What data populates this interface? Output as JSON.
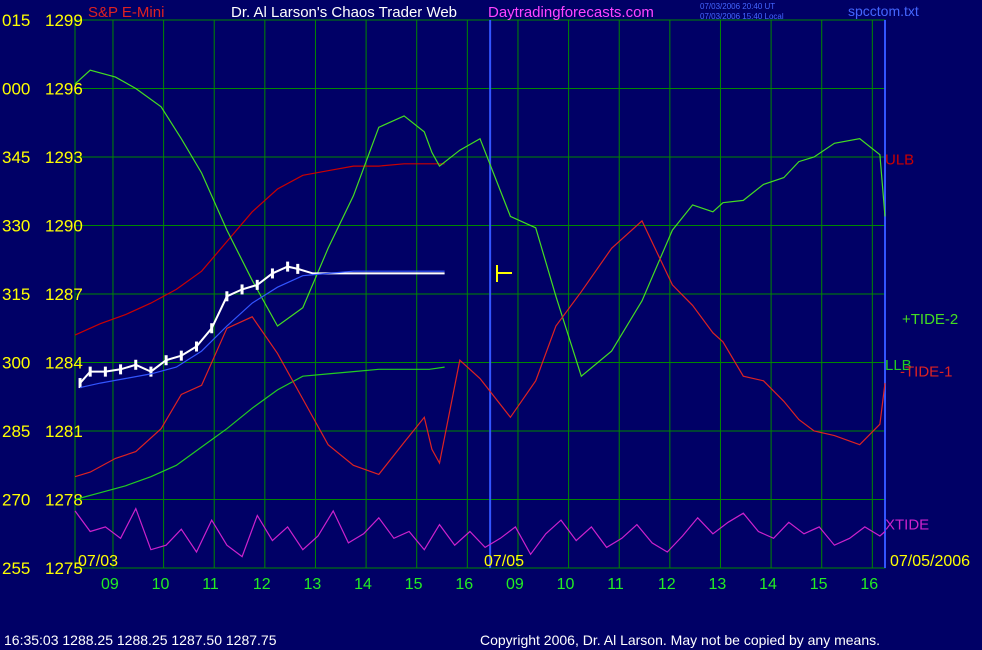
{
  "header": {
    "symbol": "S&P E-Mini",
    "title": "Dr. Al Larson's Chaos Trader Web",
    "site": "Daytradingforecasts.com",
    "timestamp_ut": "07/03/2006 20:40 UT",
    "timestamp_local": "07/03/2006 15:40 Local",
    "file": "spcctom.txt"
  },
  "footer": {
    "quote": "16:35:03  1288.25 1288.25 1287.50 1287.75",
    "copyright": "Copyright 2006, Dr. Al Larson. May not be copied by any means."
  },
  "colors": {
    "background": "#000066",
    "grid": "#008800",
    "price": "#ffffff",
    "ulb": "#cc0000",
    "llb": "#22cc22",
    "tide2": "#44dd22",
    "tide1": "#dd2222",
    "xtide": "#cc22cc",
    "ma": "#3355ff",
    "date_label": "#ffff00",
    "hour_label": "#22ee22",
    "left_axis": "#ffff00",
    "title": "#ffffff",
    "site": "#ff44ff"
  },
  "chart_data": {
    "type": "line",
    "title": "Dr. Al Larson's Chaos Trader Web",
    "y_axis": {
      "ticks": [
        1278,
        1281,
        1284,
        1287,
        1290,
        1293,
        1296,
        1299
      ],
      "ylim": [
        1278,
        1299
      ],
      "left_labels": [
        "255",
        "270",
        "285",
        "300",
        "315",
        "330",
        "345",
        "000",
        "015"
      ],
      "right_labels_top": [
        "1275",
        "1278",
        "1281",
        "1284",
        "1287",
        "1290",
        "1293",
        "1296",
        "1299"
      ]
    },
    "x_axis": {
      "hours": [
        "09",
        "10",
        "11",
        "12",
        "13",
        "14",
        "15",
        "16",
        "09",
        "10",
        "11",
        "12",
        "13",
        "14",
        "15",
        "16"
      ],
      "dates": [
        "07/03",
        "07/05",
        "07/05/2006"
      ],
      "xlim": [
        8.25,
        16
      ]
    },
    "series": [
      {
        "name": "ULB",
        "color_key": "ulb",
        "x": [
          0,
          0.5,
          1.0,
          1.5,
          2.0,
          2.5,
          3.0,
          3.5,
          4.0,
          4.5,
          5.0,
          5.5,
          6.0,
          6.5,
          7.0,
          7.3
        ],
        "y": [
          1285.2,
          1285.7,
          1286.1,
          1286.6,
          1287.2,
          1288.0,
          1289.3,
          1290.6,
          1291.6,
          1292.2,
          1292.4,
          1292.6,
          1292.6,
          1292.7,
          1292.7,
          1292.7
        ]
      },
      {
        "name": "LLB",
        "color_key": "llb",
        "x": [
          0,
          0.5,
          1.0,
          1.5,
          2.0,
          2.5,
          3.0,
          3.5,
          4.0,
          4.5,
          5.0,
          5.5,
          6.0,
          6.5,
          7.0,
          7.3
        ],
        "y": [
          1278.0,
          1278.3,
          1278.6,
          1279.0,
          1279.5,
          1280.3,
          1281.1,
          1282.0,
          1282.8,
          1283.4,
          1283.5,
          1283.6,
          1283.7,
          1283.7,
          1283.7,
          1283.8
        ]
      },
      {
        "name": "+TIDE-2",
        "color_key": "tide2",
        "x": [
          0,
          0.3,
          0.8,
          1.2,
          1.7,
          2.1,
          2.5,
          3.0,
          3.5,
          4.0,
          4.5,
          5.0,
          5.5,
          6.0,
          6.5,
          6.9,
          7.05,
          7.2,
          7.6,
          8.0,
          8.6,
          9.1,
          9.5,
          10.0,
          10.6,
          11.2,
          11.8,
          12.2,
          12.6,
          12.8,
          13.2,
          13.6,
          14.0,
          14.3,
          14.6,
          15.0,
          15.5,
          15.9,
          16.0
        ],
        "y": [
          1296.2,
          1296.8,
          1296.5,
          1296.0,
          1295.2,
          1293.8,
          1292.3,
          1289.8,
          1287.6,
          1285.6,
          1286.4,
          1289.0,
          1291.3,
          1294.3,
          1294.8,
          1294.1,
          1293.2,
          1292.6,
          1293.3,
          1293.8,
          1290.4,
          1289.9,
          1286.9,
          1283.4,
          1284.5,
          1286.7,
          1289.8,
          1290.9,
          1290.6,
          1291.0,
          1291.1,
          1291.8,
          1292.1,
          1292.8,
          1293.0,
          1293.6,
          1293.8,
          1293.1,
          1290.4
        ]
      },
      {
        "name": "-TIDE-1",
        "color_key": "tide1",
        "x": [
          0,
          0.3,
          0.8,
          1.2,
          1.7,
          2.1,
          2.5,
          3.0,
          3.5,
          4.0,
          4.5,
          5.0,
          5.5,
          6.0,
          6.5,
          6.9,
          7.05,
          7.2,
          7.6,
          8.0,
          8.6,
          9.1,
          9.5,
          10.0,
          10.6,
          11.2,
          11.8,
          12.2,
          12.6,
          12.8,
          13.2,
          13.6,
          14.0,
          14.3,
          14.6,
          15.0,
          15.5,
          15.9,
          16.0
        ],
        "y": [
          1279.0,
          1279.2,
          1279.8,
          1280.1,
          1281.1,
          1282.6,
          1283.0,
          1285.5,
          1286.0,
          1284.4,
          1282.4,
          1280.4,
          1279.5,
          1279.1,
          1280.5,
          1281.6,
          1280.2,
          1279.6,
          1284.1,
          1283.3,
          1281.6,
          1283.2,
          1285.6,
          1287.1,
          1289.0,
          1290.2,
          1287.4,
          1286.5,
          1285.3,
          1284.9,
          1283.4,
          1283.2,
          1282.3,
          1281.5,
          1281.0,
          1280.8,
          1280.4,
          1281.3,
          1283.1
        ]
      },
      {
        "name": "Price",
        "color_key": "price",
        "x": [
          0.1,
          0.3,
          0.6,
          0.9,
          1.2,
          1.5,
          1.8,
          2.1,
          2.4,
          2.7,
          3.0,
          3.3,
          3.6,
          3.9,
          4.2,
          4.4,
          4.7,
          5.0,
          5.5,
          6.0,
          6.5,
          7.0,
          7.3
        ],
        "y": [
          1283.1,
          1283.6,
          1283.6,
          1283.7,
          1283.9,
          1283.6,
          1284.1,
          1284.3,
          1284.7,
          1285.5,
          1286.9,
          1287.2,
          1287.4,
          1287.9,
          1288.2,
          1288.1,
          1287.9,
          1287.9,
          1287.9,
          1287.9,
          1287.9,
          1287.9,
          1287.9
        ]
      },
      {
        "name": "MA",
        "color_key": "ma",
        "x": [
          0.1,
          0.5,
          1.0,
          1.5,
          2.0,
          2.5,
          3.0,
          3.5,
          4.0,
          4.5,
          5.0,
          5.5,
          6.0,
          6.5,
          7.0,
          7.3
        ],
        "y": [
          1282.9,
          1283.1,
          1283.3,
          1283.5,
          1283.8,
          1284.5,
          1285.6,
          1286.6,
          1287.3,
          1287.8,
          1287.9,
          1288.0,
          1288.0,
          1288.0,
          1288.0,
          1288.0
        ]
      },
      {
        "name": "XTIDE",
        "color_key": "xtide",
        "x": [
          0,
          0.3,
          0.6,
          0.9,
          1.2,
          1.5,
          1.8,
          2.1,
          2.4,
          2.7,
          3.0,
          3.3,
          3.6,
          3.9,
          4.2,
          4.5,
          4.8,
          5.1,
          5.4,
          5.7,
          6.0,
          6.3,
          6.6,
          6.9,
          7.2,
          7.5,
          7.8,
          8.1,
          8.4,
          8.7,
          9.0,
          9.3,
          9.6,
          9.9,
          10.2,
          10.5,
          10.8,
          11.1,
          11.4,
          11.7,
          12.0,
          12.3,
          12.6,
          12.9,
          13.2,
          13.5,
          13.8,
          14.1,
          14.4,
          14.7,
          15.0,
          15.3,
          15.6,
          15.9,
          16.0
        ],
        "y": [
          1277.5,
          1276.6,
          1276.8,
          1276.3,
          1277.6,
          1275.8,
          1276.0,
          1276.7,
          1275.7,
          1277.1,
          1276.0,
          1275.5,
          1277.3,
          1276.2,
          1276.8,
          1275.8,
          1276.4,
          1277.5,
          1276.1,
          1276.5,
          1277.2,
          1276.3,
          1276.6,
          1275.8,
          1276.9,
          1276.0,
          1276.6,
          1275.9,
          1276.3,
          1276.8,
          1275.6,
          1276.5,
          1277.1,
          1276.2,
          1276.8,
          1275.9,
          1276.3,
          1276.9,
          1276.1,
          1275.7,
          1276.4,
          1277.2,
          1276.5,
          1277.0,
          1277.4,
          1276.6,
          1276.3,
          1277.0,
          1276.5,
          1276.8,
          1276.0,
          1276.3,
          1276.8,
          1276.4,
          1276.6
        ]
      }
    ],
    "labels": [
      {
        "text": "ULB",
        "color_key": "ulb",
        "y": 1292.9
      },
      {
        "text": "+TIDE-2",
        "color_key": "tide2",
        "y": 1285.9
      },
      {
        "text": "LLB",
        "color_key": "llb",
        "y": 1283.9
      },
      {
        "text": "-TIDE-1",
        "color_key": "tide1",
        "y": 1283.6
      },
      {
        "text": "XTIDE",
        "color_key": "xtide",
        "y": 1276.9
      }
    ]
  }
}
